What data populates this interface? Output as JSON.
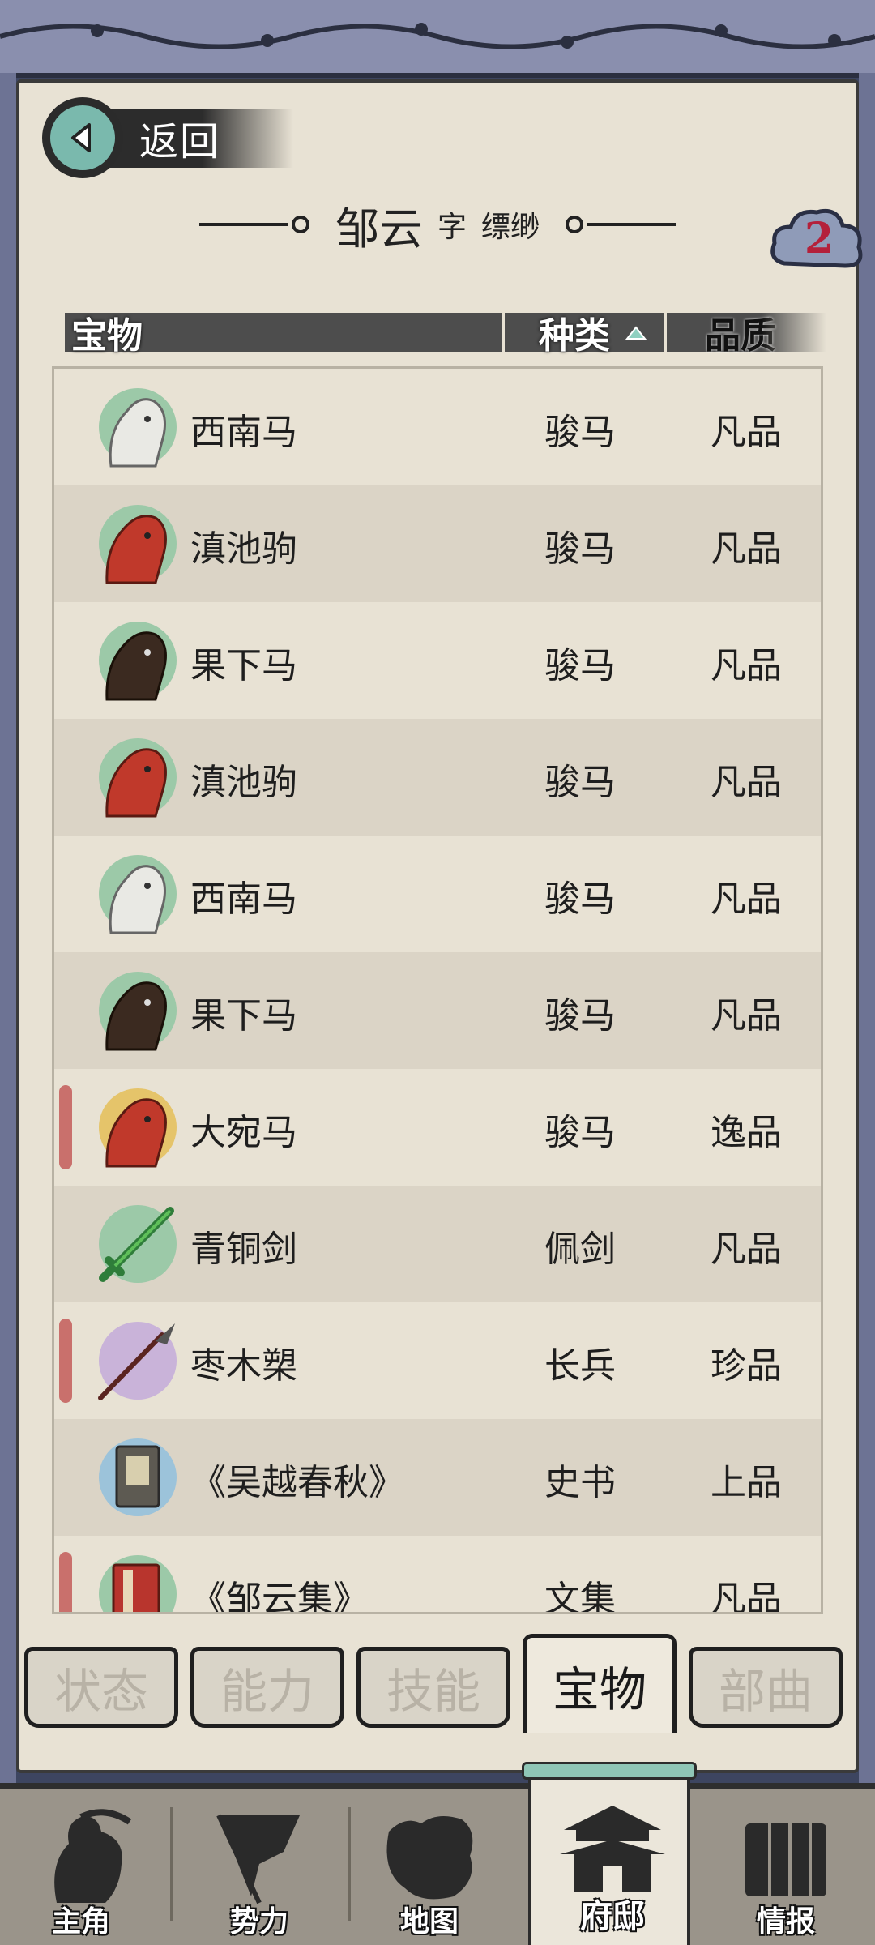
{
  "back_button": {
    "label": "返回"
  },
  "character": {
    "name": "邹云",
    "zi_label": "字",
    "courtesy_name": "缥缈"
  },
  "badge": {
    "count": "2"
  },
  "table": {
    "headers": {
      "item": "宝物",
      "type": "种类",
      "quality": "品质"
    },
    "sort": {
      "column": "type",
      "direction": "asc"
    }
  },
  "items": [
    {
      "name": "西南马",
      "type": "骏马",
      "quality": "凡品",
      "icon": "white-horse-icon",
      "marked": false
    },
    {
      "name": "滇池驹",
      "type": "骏马",
      "quality": "凡品",
      "icon": "red-horse-icon",
      "marked": false
    },
    {
      "name": "果下马",
      "type": "骏马",
      "quality": "凡品",
      "icon": "dark-horse-icon",
      "marked": false
    },
    {
      "name": "滇池驹",
      "type": "骏马",
      "quality": "凡品",
      "icon": "red-horse-icon",
      "marked": false
    },
    {
      "name": "西南马",
      "type": "骏马",
      "quality": "凡品",
      "icon": "white-horse-icon",
      "marked": false
    },
    {
      "name": "果下马",
      "type": "骏马",
      "quality": "凡品",
      "icon": "dark-horse-icon",
      "marked": false
    },
    {
      "name": "大宛马",
      "type": "骏马",
      "quality": "逸品",
      "icon": "red-horse-gold-icon",
      "marked": true
    },
    {
      "name": "青铜剑",
      "type": "佩剑",
      "quality": "凡品",
      "icon": "bronze-sword-icon",
      "marked": false
    },
    {
      "name": "枣木槊",
      "type": "长兵",
      "quality": "珍品",
      "icon": "spear-icon",
      "marked": true
    },
    {
      "name": "《吴越春秋》",
      "type": "史书",
      "quality": "上品",
      "icon": "history-book-icon",
      "marked": false
    },
    {
      "name": "《邹云集》",
      "type": "文集",
      "quality": "凡品",
      "icon": "collection-book-icon",
      "marked": true
    }
  ],
  "tabs": [
    {
      "label": "状态",
      "active": false
    },
    {
      "label": "能力",
      "active": false
    },
    {
      "label": "技能",
      "active": false
    },
    {
      "label": "宝物",
      "active": true
    },
    {
      "label": "部曲",
      "active": false
    }
  ],
  "bottom_nav": [
    {
      "label": "主角",
      "icon": "warrior-icon",
      "active": false
    },
    {
      "label": "势力",
      "icon": "flag-icon",
      "active": false
    },
    {
      "label": "地图",
      "icon": "map-icon",
      "active": false
    },
    {
      "label": "府邸",
      "icon": "mansion-icon",
      "active": true
    },
    {
      "label": "情报",
      "icon": "scroll-icon",
      "active": false
    }
  ],
  "colors": {
    "parchment": "#e8e2d4",
    "frame": "#3d4560",
    "accent_teal": "#7ab9ad",
    "mark_red": "#c9706c",
    "badge_red": "#b4203a"
  }
}
